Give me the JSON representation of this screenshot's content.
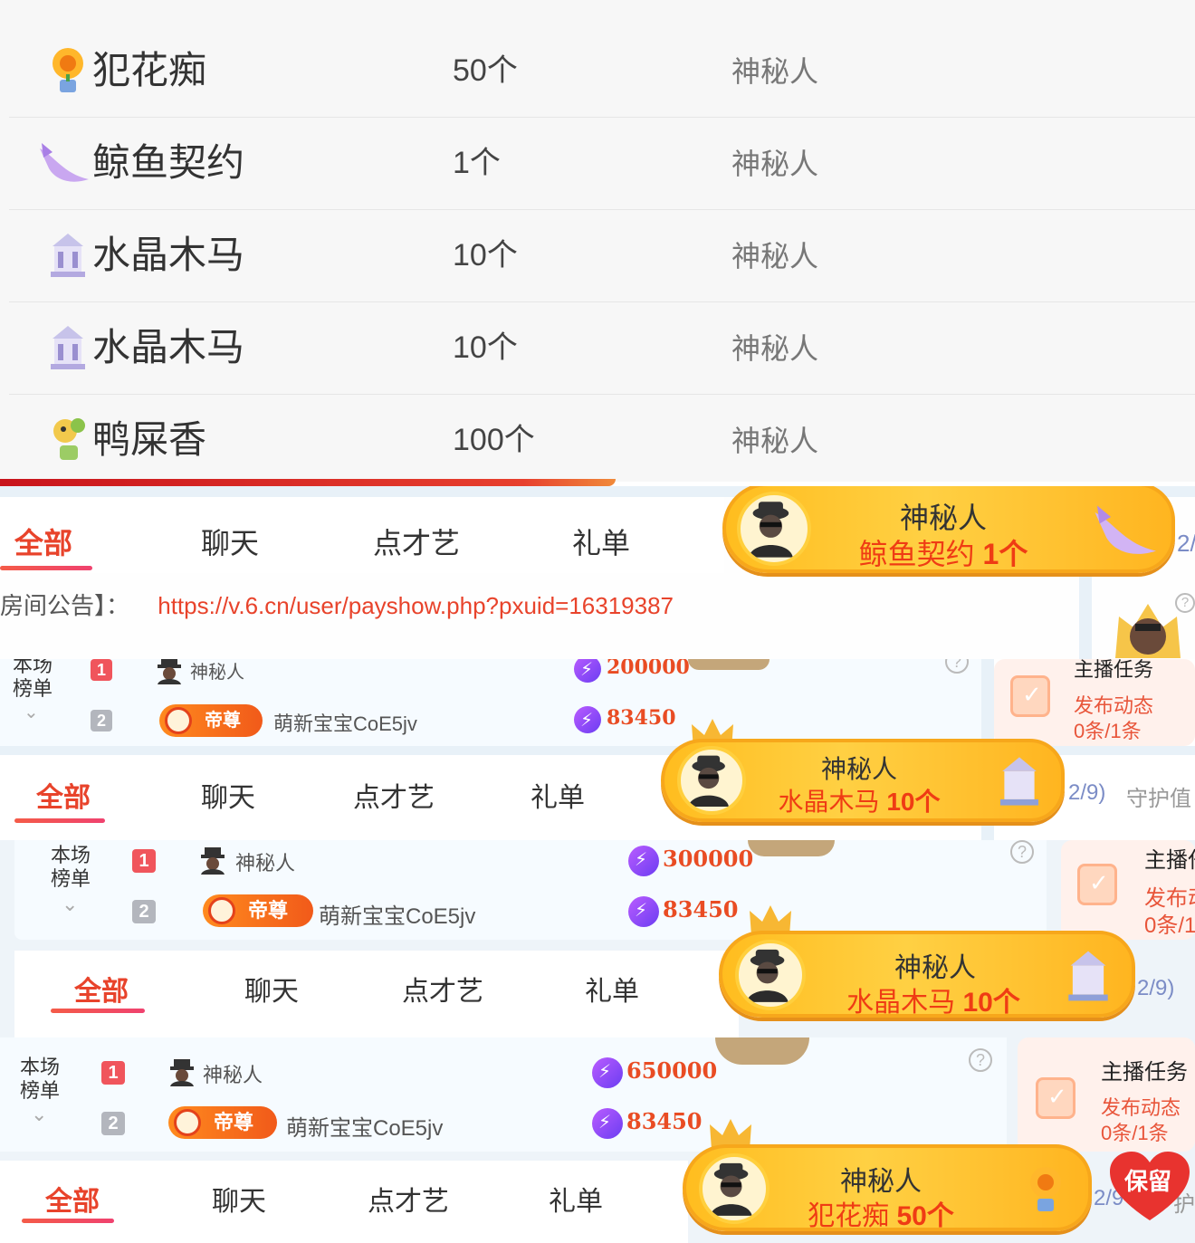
{
  "gifts": [
    {
      "name": "犯花痴",
      "count": "50个",
      "sender": "神秘人",
      "icon": "sunflower-icon"
    },
    {
      "name": "鲸鱼契约",
      "count": "1个",
      "sender": "神秘人",
      "icon": "whale-icon"
    },
    {
      "name": "水晶木马",
      "count": "10个",
      "sender": "神秘人",
      "icon": "carousel-icon"
    },
    {
      "name": "水晶木马",
      "count": "10个",
      "sender": "神秘人",
      "icon": "carousel-icon"
    },
    {
      "name": "鸭屎香",
      "count": "100个",
      "sender": "神秘人",
      "icon": "duck-flower-icon"
    }
  ],
  "tabs": [
    "全部",
    "聊天",
    "点才艺",
    "礼单"
  ],
  "announcement": {
    "label": "房间公告】：",
    "url": "https://v.6.cn/user/payshow.php?pxuid=16319387"
  },
  "rank": {
    "title": "本场\n榜单",
    "rows": [
      {
        "num": "1",
        "name": "神秘人"
      },
      {
        "num": "2",
        "badge": "帝尊",
        "name": "萌新宝宝CoE5jv"
      }
    ]
  },
  "strips": [
    {
      "toast_sender": "神秘人",
      "toast_gift": "鲸鱼契约",
      "toast_count": "1个",
      "side": "2/"
    },
    {
      "score1": "200000",
      "score2": "83450",
      "toast_sender": "神秘人",
      "toast_gift": "水晶木马",
      "toast_count": "10个",
      "side": "2/9)",
      "side2": "守护值"
    },
    {
      "score1": "300000",
      "score2": "83450",
      "toast_sender": "神秘人",
      "toast_gift": "水晶木马",
      "toast_count": "10个",
      "side": "2/9)"
    },
    {
      "score1": "650000",
      "score2": "83450",
      "toast_sender": "神秘人",
      "toast_gift": "犯花痴",
      "toast_count": "50个",
      "side": "2/9",
      "side2": "护"
    }
  ],
  "task": {
    "title": "主播任务",
    "sub1": "发布动态",
    "sub2": "0条/1条"
  },
  "save_label": "保留",
  "colors": {
    "accent": "#e8432b",
    "toast": "#ffc62e",
    "rank_bg": "#f6fbff"
  }
}
